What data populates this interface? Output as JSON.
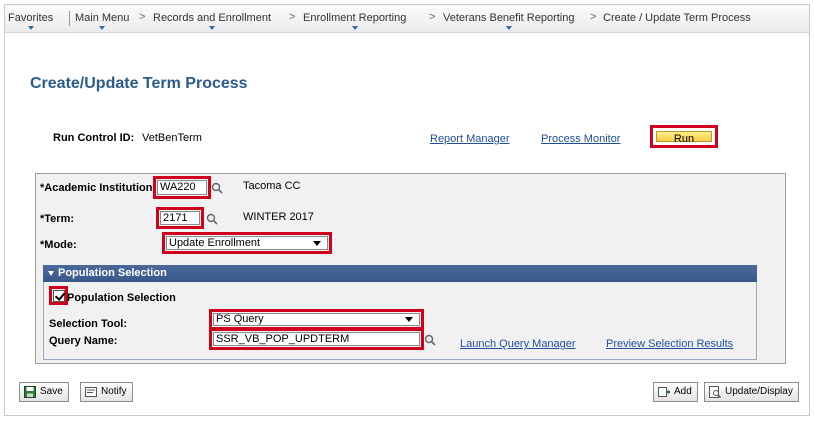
{
  "breadcrumb": {
    "items": [
      "Favorites",
      "Main Menu",
      "Records and Enrollment",
      "Enrollment Reporting",
      "Veterans Benefit Reporting",
      "Create / Update Term Process"
    ],
    "separator": ">"
  },
  "page": {
    "title": "Create/Update Term Process"
  },
  "run_control": {
    "label": "Run Control ID:",
    "value": "VetBenTerm"
  },
  "links": {
    "report_manager": "Report Manager",
    "process_monitor": "Process Monitor"
  },
  "run_button": {
    "label": "Run"
  },
  "form": {
    "institution": {
      "label": "*Academic Institution:",
      "value": "WA220",
      "description": "Tacoma CC"
    },
    "term": {
      "label": "*Term:",
      "value": "2171",
      "description": "WINTER 2017"
    },
    "mode": {
      "label": "*Mode:",
      "value": "Update Enrollment"
    }
  },
  "population": {
    "section_title": "Population Selection",
    "checkbox_label": "Population Selection",
    "checked": true,
    "selection_tool": {
      "label": "Selection Tool:",
      "value": "PS Query"
    },
    "query_name": {
      "label": "Query Name:",
      "value": "SSR_VB_POP_UPDTERM"
    },
    "launch_link": "Launch Query Manager",
    "preview_link": "Preview Selection Results"
  },
  "toolbar": {
    "save": "Save",
    "notify": "Notify",
    "add": "Add",
    "update_display": "Update/Display"
  },
  "colors": {
    "highlight": "#d0021b",
    "title": "#2b5c8c",
    "link": "#1f4f9c",
    "section_header": "#3f5e90"
  }
}
